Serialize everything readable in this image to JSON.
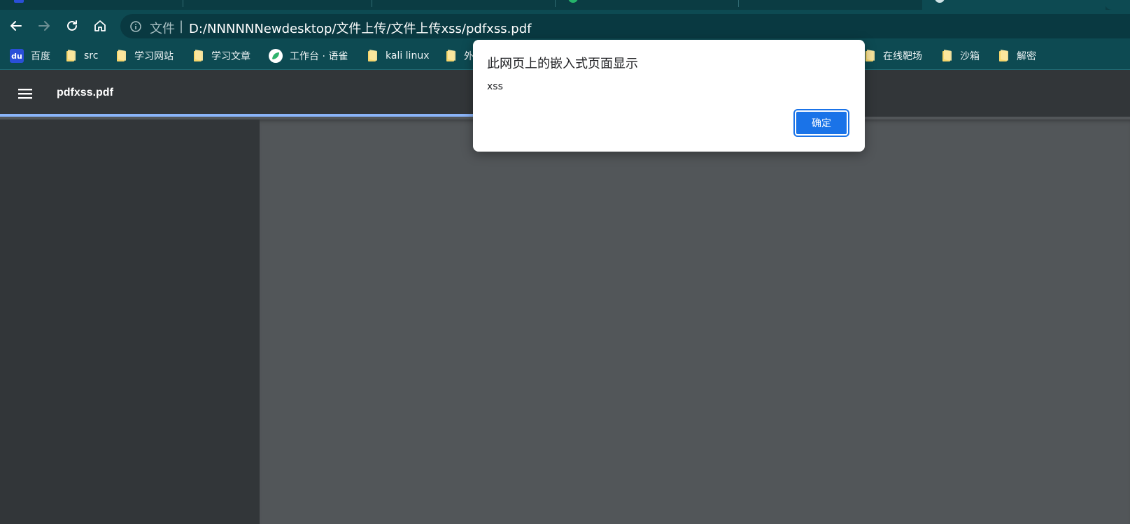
{
  "browser": {
    "omnibox": {
      "scheme_label": "文件",
      "separator": "|",
      "url": "D:/NNNNNNewdesktop/文件上传/文件上传xss/pdfxss.pdf"
    },
    "bookmarks": [
      {
        "label": "百度",
        "icon": "baidu-icon"
      },
      {
        "label": "src",
        "icon": "folder-icon"
      },
      {
        "label": "学习网站",
        "icon": "folder-icon"
      },
      {
        "label": "学习文章",
        "icon": "folder-icon"
      },
      {
        "label": "工作台 · 语雀",
        "icon": "yuque-icon"
      },
      {
        "label": "kali linux",
        "icon": "folder-icon"
      },
      {
        "label": "外",
        "icon": "folder-icon"
      },
      {
        "label": "在线靶场",
        "icon": "folder-icon"
      },
      {
        "label": "沙箱",
        "icon": "folder-icon"
      },
      {
        "label": "解密",
        "icon": "folder-icon"
      }
    ]
  },
  "pdf_viewer": {
    "file_name": "pdfxss.pdf",
    "load_progress": 0.42
  },
  "dialog": {
    "title": "此网页上的嵌入式页面显示",
    "message": "xss",
    "ok_label": "确定"
  },
  "colors": {
    "chrome_bg": "#0d4a52",
    "omnibox_bg": "#093941",
    "pdf_toolbar": "#323639",
    "pdf_canvas": "#525659",
    "accent_blue": "#1a73e8",
    "progress_blue": "#8ab4f8"
  }
}
